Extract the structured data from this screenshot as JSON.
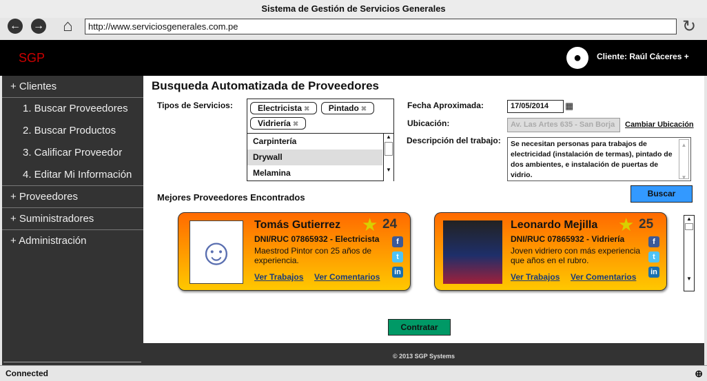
{
  "window": {
    "title": "Sistema de Gestión de Servicios Generales",
    "url": "http://www.serviciosgenerales.com.pe",
    "status": "Connected"
  },
  "header": {
    "logo": "SGP",
    "user": "Cliente: Raúl Cáceres +"
  },
  "sidebar": {
    "items": [
      {
        "label": "+ Clientes"
      },
      {
        "label": "1. Buscar Proveedores"
      },
      {
        "label": "2. Buscar Productos"
      },
      {
        "label": "3. Calificar Proveedor"
      },
      {
        "label": "4. Editar Mi Información"
      },
      {
        "label": "+ Proveedores"
      },
      {
        "label": "+ Suministradores"
      },
      {
        "label": "+ Administración"
      }
    ]
  },
  "main": {
    "title": "Busqueda Automatizada de Proveedores",
    "services_label": "Tipos de Servicios:",
    "selected_tags": [
      "Electricista",
      "Pintado",
      "Vidriería"
    ],
    "options": [
      "Carpintería",
      "Drywall",
      "Melamina"
    ],
    "date_label": "Fecha Aproximada:",
    "date_value": "17/05/2014",
    "location_label": "Ubicación:",
    "location_value": "Av. Las Artes 635 - San Borja",
    "change_location": "Cambiar Ubicación",
    "desc_label": "Descripción del trabajo:",
    "desc_value": "Se necesitan personas para trabajos de electricidad (instalación de termas), pintado de dos ambientes, e instalación de puertas de vidrio.",
    "search_button": "Buscar",
    "results_title": "Mejores Proveedores Encontrados",
    "providers": [
      {
        "name": "Tomás Gutierrez",
        "score": "24",
        "dni": "DNI/RUC 07865932 - Electricista",
        "desc": "Maestrod Pintor con 25 años de experiencia.",
        "link1": "Ver Trabajos",
        "link2": "Ver Comentarios"
      },
      {
        "name": "Leonardo Mejilla",
        "score": "25",
        "dni": "DNI/RUC 07865932 - Vidriería",
        "desc": "Joven vidriero con más experiencia que años en el rubro.",
        "link1": "Ver Trabajos",
        "link2": "Ver Comentarios"
      }
    ],
    "hire_button": "Contratar"
  },
  "footer": {
    "text": "© 2013 SGP Systems"
  },
  "colors": {
    "accent": "#3399ff",
    "hire": "#009966",
    "logo": "#cc0000"
  }
}
